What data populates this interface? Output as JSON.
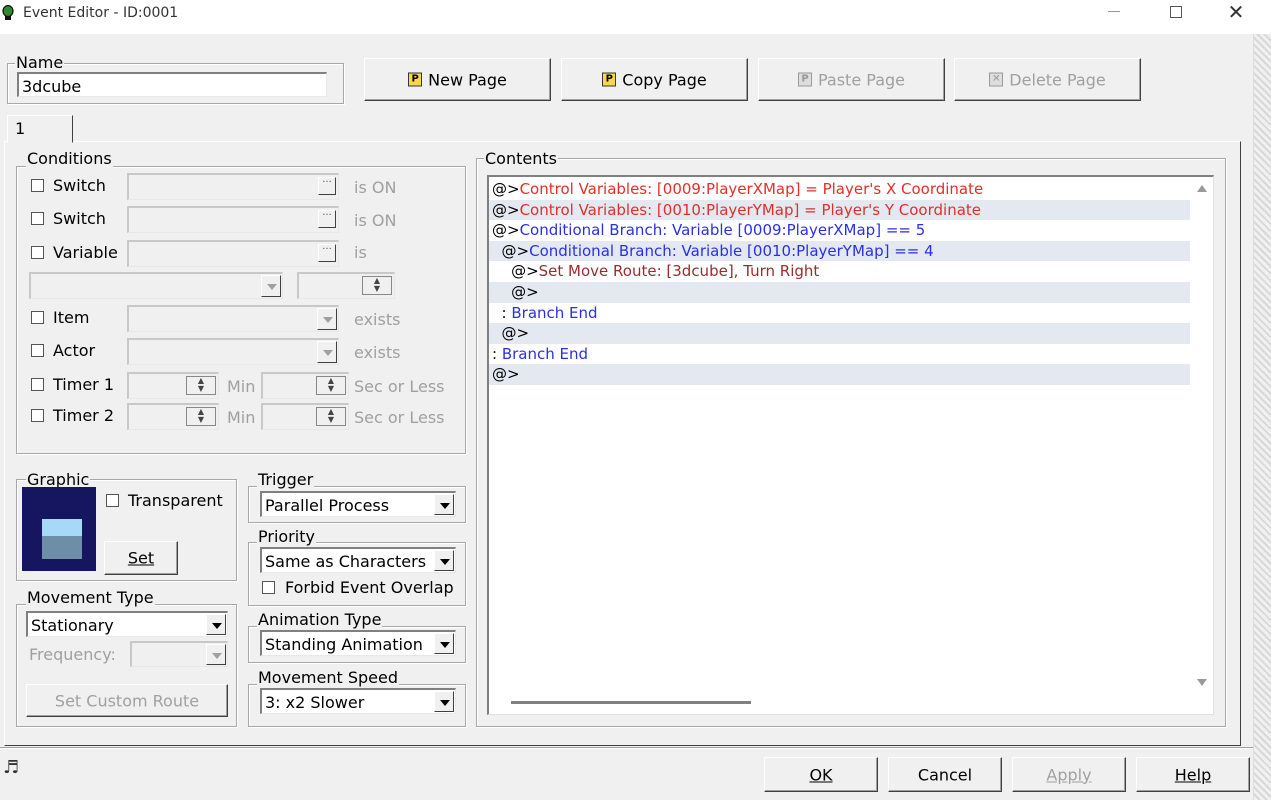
{
  "window": {
    "title": "Event Editor - ID:0001"
  },
  "name_group": {
    "label": "Name",
    "value": "3dcube"
  },
  "page_buttons": {
    "new_page": "New Page",
    "copy_page": "Copy Page",
    "paste_page": "Paste Page",
    "delete_page": "Delete Page"
  },
  "tabs": [
    {
      "label": "1"
    }
  ],
  "conditions": {
    "label": "Conditions",
    "switch1": {
      "label": "Switch",
      "suffix": "is ON"
    },
    "switch2": {
      "label": "Switch",
      "suffix": "is ON"
    },
    "variable": {
      "label": "Variable",
      "suffix": "is"
    },
    "item": {
      "label": "Item",
      "suffix": "exists"
    },
    "actor": {
      "label": "Actor",
      "suffix": "exists"
    },
    "timer1": {
      "label": "Timer 1",
      "unit_min": "Min",
      "unit_sec": "Sec or Less"
    },
    "timer2": {
      "label": "Timer 2",
      "unit_min": "Min",
      "unit_sec": "Sec or Less"
    }
  },
  "graphic": {
    "label": "Graphic",
    "transparent_label": "Transparent",
    "set_button": "Set"
  },
  "trigger": {
    "label": "Trigger",
    "value": "Parallel Process"
  },
  "priority": {
    "label": "Priority",
    "value": "Same as Characters",
    "forbid_label": "Forbid Event Overlap"
  },
  "movement_type": {
    "label": "Movement Type",
    "value": "Stationary",
    "frequency_label": "Frequency:",
    "custom_route_button": "Set Custom Route"
  },
  "animation_type": {
    "label": "Animation Type",
    "value": "Standing Animation"
  },
  "movement_speed": {
    "label": "Movement Speed",
    "value": "3: x2 Slower"
  },
  "contents": {
    "label": "Contents",
    "lines": [
      {
        "prefix": "@>",
        "text": "Control Variables: [0009:PlayerXMap] = Player's X Coordinate",
        "color": "red",
        "alt": false
      },
      {
        "prefix": "@>",
        "text": "Control Variables: [0010:PlayerYMap] = Player's Y Coordinate",
        "color": "red",
        "alt": true
      },
      {
        "prefix": "@>",
        "text": "Conditional Branch: Variable [0009:PlayerXMap] == 5",
        "color": "blue",
        "alt": false
      },
      {
        "prefix": "  @>",
        "text": "Conditional Branch: Variable [0010:PlayerYMap] == 4",
        "color": "blue",
        "alt": true
      },
      {
        "prefix": "    @>",
        "text": "Set Move Route: [3dcube], Turn Right",
        "color": "maroon",
        "alt": false
      },
      {
        "prefix": "    @>",
        "text": "",
        "color": "black",
        "alt": true
      },
      {
        "prefix": "  : ",
        "text": "Branch End",
        "color": "blue",
        "alt": false
      },
      {
        "prefix": "  @>",
        "text": "",
        "color": "black",
        "alt": true
      },
      {
        "prefix": ": ",
        "text": "Branch End",
        "color": "blue",
        "alt": false
      },
      {
        "prefix": "@>",
        "text": "",
        "color": "black",
        "alt": true
      }
    ]
  },
  "dialog_buttons": {
    "ok": "OK",
    "cancel": "Cancel",
    "apply": "Apply",
    "help": "Help"
  }
}
